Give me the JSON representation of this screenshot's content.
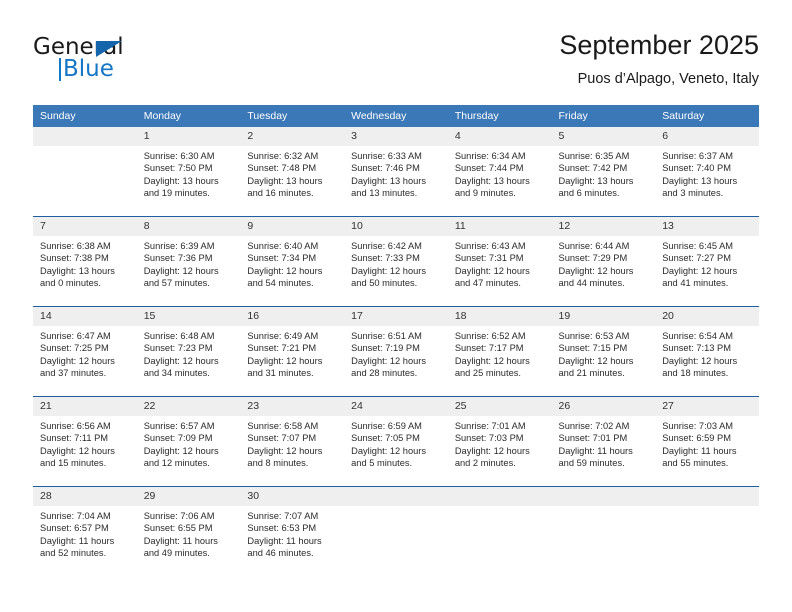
{
  "logo": {
    "word_general": "General",
    "word_blue": "Blue",
    "triangle_color": "#1565ad",
    "blue_color": "#1676c6"
  },
  "header": {
    "month_title": "September 2025",
    "location": "Puos d’Alpago, Veneto, Italy"
  },
  "theme": {
    "header_bg": "#3b78b8",
    "row_divider": "#1f5fa0",
    "daynum_bg": "#efefef"
  },
  "calendar": {
    "day_headers": [
      "Sunday",
      "Monday",
      "Tuesday",
      "Wednesday",
      "Thursday",
      "Friday",
      "Saturday"
    ],
    "weeks": [
      [
        {
          "day": "",
          "sunrise": "",
          "sunset": "",
          "daylight_line1": "",
          "daylight_line2": ""
        },
        {
          "day": "1",
          "sunrise": "Sunrise: 6:30 AM",
          "sunset": "Sunset: 7:50 PM",
          "daylight_line1": "Daylight: 13 hours",
          "daylight_line2": "and 19 minutes."
        },
        {
          "day": "2",
          "sunrise": "Sunrise: 6:32 AM",
          "sunset": "Sunset: 7:48 PM",
          "daylight_line1": "Daylight: 13 hours",
          "daylight_line2": "and 16 minutes."
        },
        {
          "day": "3",
          "sunrise": "Sunrise: 6:33 AM",
          "sunset": "Sunset: 7:46 PM",
          "daylight_line1": "Daylight: 13 hours",
          "daylight_line2": "and 13 minutes."
        },
        {
          "day": "4",
          "sunrise": "Sunrise: 6:34 AM",
          "sunset": "Sunset: 7:44 PM",
          "daylight_line1": "Daylight: 13 hours",
          "daylight_line2": "and 9 minutes."
        },
        {
          "day": "5",
          "sunrise": "Sunrise: 6:35 AM",
          "sunset": "Sunset: 7:42 PM",
          "daylight_line1": "Daylight: 13 hours",
          "daylight_line2": "and 6 minutes."
        },
        {
          "day": "6",
          "sunrise": "Sunrise: 6:37 AM",
          "sunset": "Sunset: 7:40 PM",
          "daylight_line1": "Daylight: 13 hours",
          "daylight_line2": "and 3 minutes."
        }
      ],
      [
        {
          "day": "7",
          "sunrise": "Sunrise: 6:38 AM",
          "sunset": "Sunset: 7:38 PM",
          "daylight_line1": "Daylight: 13 hours",
          "daylight_line2": "and 0 minutes."
        },
        {
          "day": "8",
          "sunrise": "Sunrise: 6:39 AM",
          "sunset": "Sunset: 7:36 PM",
          "daylight_line1": "Daylight: 12 hours",
          "daylight_line2": "and 57 minutes."
        },
        {
          "day": "9",
          "sunrise": "Sunrise: 6:40 AM",
          "sunset": "Sunset: 7:34 PM",
          "daylight_line1": "Daylight: 12 hours",
          "daylight_line2": "and 54 minutes."
        },
        {
          "day": "10",
          "sunrise": "Sunrise: 6:42 AM",
          "sunset": "Sunset: 7:33 PM",
          "daylight_line1": "Daylight: 12 hours",
          "daylight_line2": "and 50 minutes."
        },
        {
          "day": "11",
          "sunrise": "Sunrise: 6:43 AM",
          "sunset": "Sunset: 7:31 PM",
          "daylight_line1": "Daylight: 12 hours",
          "daylight_line2": "and 47 minutes."
        },
        {
          "day": "12",
          "sunrise": "Sunrise: 6:44 AM",
          "sunset": "Sunset: 7:29 PM",
          "daylight_line1": "Daylight: 12 hours",
          "daylight_line2": "and 44 minutes."
        },
        {
          "day": "13",
          "sunrise": "Sunrise: 6:45 AM",
          "sunset": "Sunset: 7:27 PM",
          "daylight_line1": "Daylight: 12 hours",
          "daylight_line2": "and 41 minutes."
        }
      ],
      [
        {
          "day": "14",
          "sunrise": "Sunrise: 6:47 AM",
          "sunset": "Sunset: 7:25 PM",
          "daylight_line1": "Daylight: 12 hours",
          "daylight_line2": "and 37 minutes."
        },
        {
          "day": "15",
          "sunrise": "Sunrise: 6:48 AM",
          "sunset": "Sunset: 7:23 PM",
          "daylight_line1": "Daylight: 12 hours",
          "daylight_line2": "and 34 minutes."
        },
        {
          "day": "16",
          "sunrise": "Sunrise: 6:49 AM",
          "sunset": "Sunset: 7:21 PM",
          "daylight_line1": "Daylight: 12 hours",
          "daylight_line2": "and 31 minutes."
        },
        {
          "day": "17",
          "sunrise": "Sunrise: 6:51 AM",
          "sunset": "Sunset: 7:19 PM",
          "daylight_line1": "Daylight: 12 hours",
          "daylight_line2": "and 28 minutes."
        },
        {
          "day": "18",
          "sunrise": "Sunrise: 6:52 AM",
          "sunset": "Sunset: 7:17 PM",
          "daylight_line1": "Daylight: 12 hours",
          "daylight_line2": "and 25 minutes."
        },
        {
          "day": "19",
          "sunrise": "Sunrise: 6:53 AM",
          "sunset": "Sunset: 7:15 PM",
          "daylight_line1": "Daylight: 12 hours",
          "daylight_line2": "and 21 minutes."
        },
        {
          "day": "20",
          "sunrise": "Sunrise: 6:54 AM",
          "sunset": "Sunset: 7:13 PM",
          "daylight_line1": "Daylight: 12 hours",
          "daylight_line2": "and 18 minutes."
        }
      ],
      [
        {
          "day": "21",
          "sunrise": "Sunrise: 6:56 AM",
          "sunset": "Sunset: 7:11 PM",
          "daylight_line1": "Daylight: 12 hours",
          "daylight_line2": "and 15 minutes."
        },
        {
          "day": "22",
          "sunrise": "Sunrise: 6:57 AM",
          "sunset": "Sunset: 7:09 PM",
          "daylight_line1": "Daylight: 12 hours",
          "daylight_line2": "and 12 minutes."
        },
        {
          "day": "23",
          "sunrise": "Sunrise: 6:58 AM",
          "sunset": "Sunset: 7:07 PM",
          "daylight_line1": "Daylight: 12 hours",
          "daylight_line2": "and 8 minutes."
        },
        {
          "day": "24",
          "sunrise": "Sunrise: 6:59 AM",
          "sunset": "Sunset: 7:05 PM",
          "daylight_line1": "Daylight: 12 hours",
          "daylight_line2": "and 5 minutes."
        },
        {
          "day": "25",
          "sunrise": "Sunrise: 7:01 AM",
          "sunset": "Sunset: 7:03 PM",
          "daylight_line1": "Daylight: 12 hours",
          "daylight_line2": "and 2 minutes."
        },
        {
          "day": "26",
          "sunrise": "Sunrise: 7:02 AM",
          "sunset": "Sunset: 7:01 PM",
          "daylight_line1": "Daylight: 11 hours",
          "daylight_line2": "and 59 minutes."
        },
        {
          "day": "27",
          "sunrise": "Sunrise: 7:03 AM",
          "sunset": "Sunset: 6:59 PM",
          "daylight_line1": "Daylight: 11 hours",
          "daylight_line2": "and 55 minutes."
        }
      ],
      [
        {
          "day": "28",
          "sunrise": "Sunrise: 7:04 AM",
          "sunset": "Sunset: 6:57 PM",
          "daylight_line1": "Daylight: 11 hours",
          "daylight_line2": "and 52 minutes."
        },
        {
          "day": "29",
          "sunrise": "Sunrise: 7:06 AM",
          "sunset": "Sunset: 6:55 PM",
          "daylight_line1": "Daylight: 11 hours",
          "daylight_line2": "and 49 minutes."
        },
        {
          "day": "30",
          "sunrise": "Sunrise: 7:07 AM",
          "sunset": "Sunset: 6:53 PM",
          "daylight_line1": "Daylight: 11 hours",
          "daylight_line2": "and 46 minutes."
        },
        {
          "day": "",
          "sunrise": "",
          "sunset": "",
          "daylight_line1": "",
          "daylight_line2": ""
        },
        {
          "day": "",
          "sunrise": "",
          "sunset": "",
          "daylight_line1": "",
          "daylight_line2": ""
        },
        {
          "day": "",
          "sunrise": "",
          "sunset": "",
          "daylight_line1": "",
          "daylight_line2": ""
        },
        {
          "day": "",
          "sunrise": "",
          "sunset": "",
          "daylight_line1": "",
          "daylight_line2": ""
        }
      ]
    ]
  }
}
